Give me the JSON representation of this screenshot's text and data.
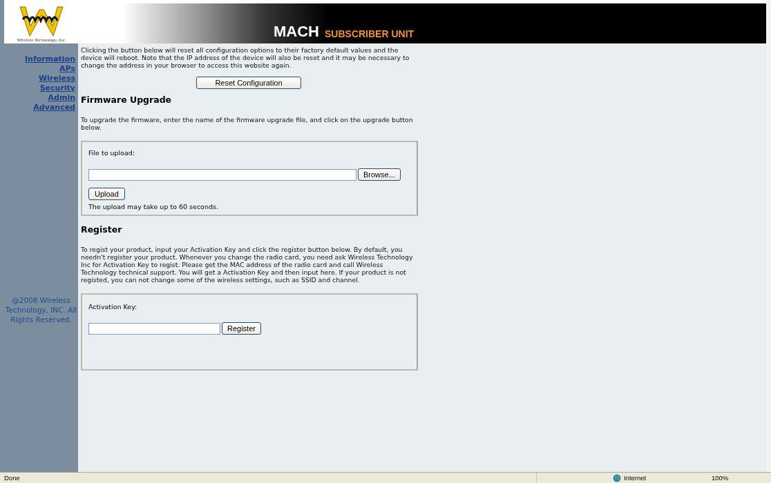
{
  "header": {
    "company": "Wireless Technology, Inc.",
    "product": "MACH",
    "subtitle": "SUBSCRIBER UNIT"
  },
  "nav": [
    {
      "label": "Information"
    },
    {
      "label": "APs"
    },
    {
      "label": "Wireless"
    },
    {
      "label": "Security"
    },
    {
      "label": "Admin"
    },
    {
      "label": "Advanced"
    }
  ],
  "copyright": "@2008 Wireless Technology, INC. All Rights Reserved.",
  "reset": {
    "text": "Clicking the button below will reset all configuration options to their factory default values and the device will reboot. Note that the IP address of the device will also be reset and it may be necessary to change the address in your browser to access this website again.",
    "button": "Reset Configuration"
  },
  "firmware": {
    "title": "Firmware Upgrade",
    "text": "To upgrade the firmware, enter the name of the firmware upgrade file, and click on the upgrade button below.",
    "field_label": "File to upload:",
    "browse_button": "Browse...",
    "upload_button": "Upload",
    "note": "The upload may take up to 60 seconds."
  },
  "register": {
    "title": "Register",
    "text": "To regist your product, input your Activation Key and click the register button below. By default, you needn't register your product. Whenever you change the radio card, you need ask Wireless Technology Inc for Activation Key to regist. Please get the MAC address of the radio card and call Wireless Technology technical support. You will get a Activation Key and then input here. If your product is not registed, you can not change some of the wireless settings, such as SSID and channel.",
    "field_label": "Activation Key:",
    "button": "Register"
  },
  "status_bar": {
    "status": "Done",
    "zone": "Internet",
    "zoom": "100%"
  }
}
